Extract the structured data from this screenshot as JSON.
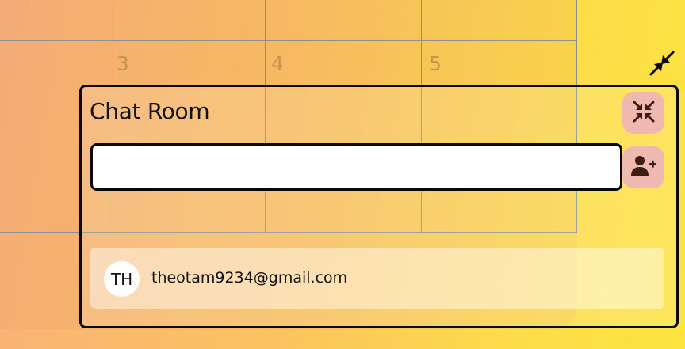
{
  "colors": {
    "border": "#0a0a0a",
    "button_bg": "#efb8b0",
    "icon": "#3d1e0e",
    "day_number": "#c9914e"
  },
  "calendar": {
    "visible_days": [
      "3",
      "4",
      "5"
    ]
  },
  "chat_room": {
    "title": "Chat Room",
    "search_value": "",
    "toolbar": {
      "collapse_button_icon": "collapse-arrows-icon",
      "add_member_button_icon": "user-plus-icon",
      "minimize_icon": "minimize-arrows-icon"
    },
    "members": [
      {
        "initials": "TH",
        "email": "theotam9234@gmail.com"
      }
    ]
  }
}
